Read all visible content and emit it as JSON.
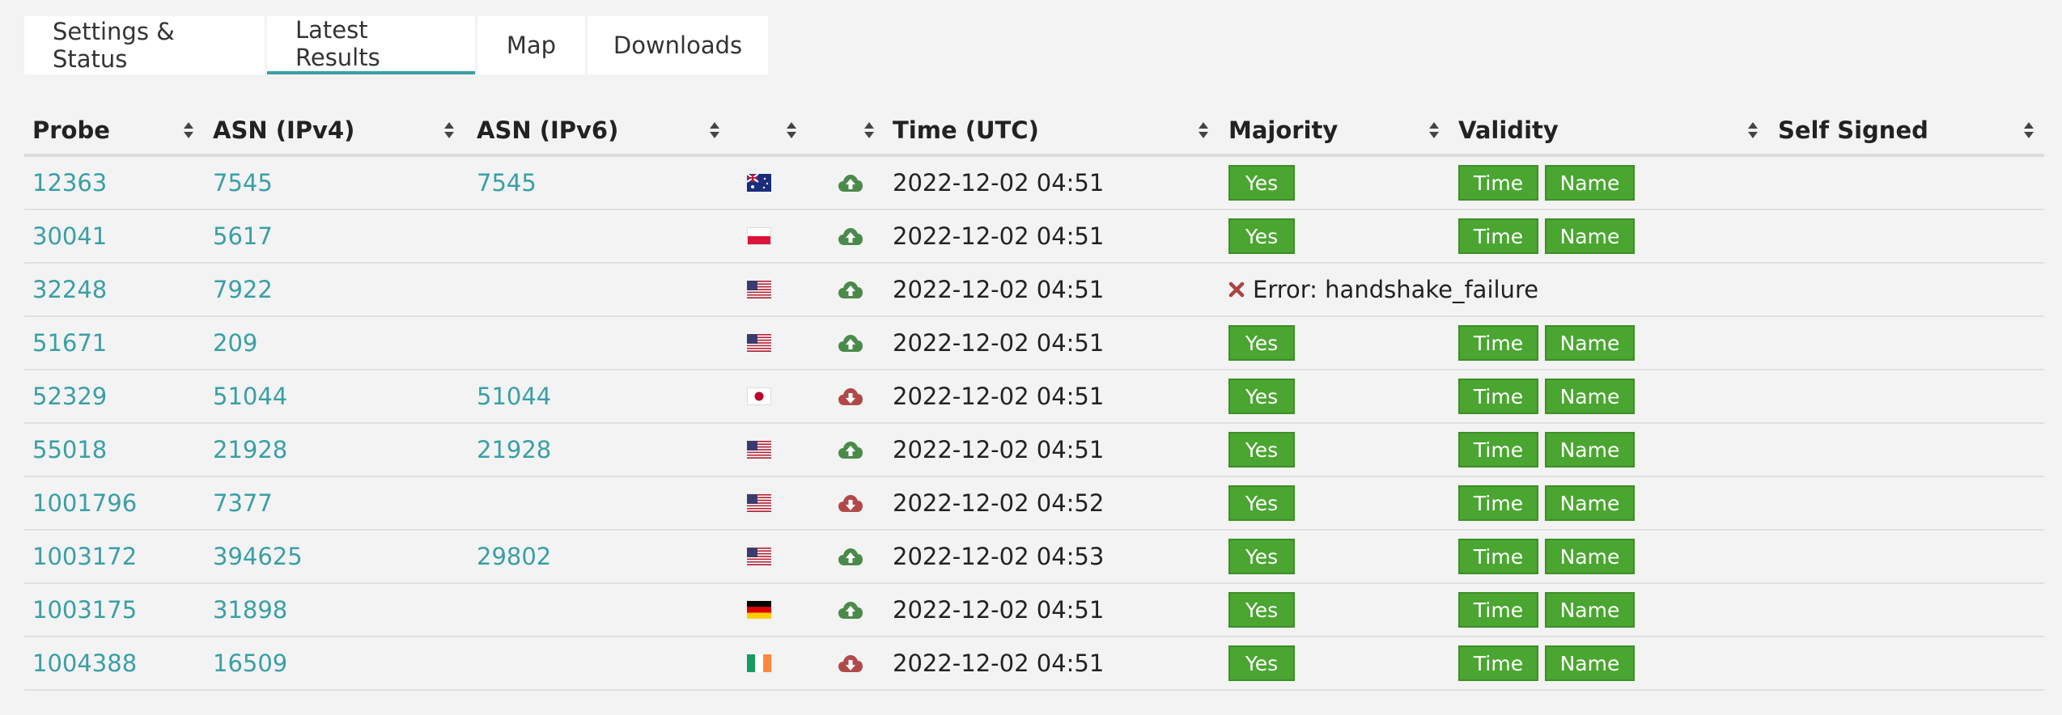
{
  "tabs": [
    {
      "label": "Settings & Status",
      "active": false
    },
    {
      "label": "Latest Results",
      "active": true
    },
    {
      "label": "Map",
      "active": false
    },
    {
      "label": "Downloads",
      "active": false
    }
  ],
  "table": {
    "headers": [
      "Probe",
      "ASN (IPv4)",
      "ASN (IPv6)",
      "",
      "",
      "Time (UTC)",
      "Majority",
      "Validity",
      "Self Signed"
    ],
    "rows": [
      {
        "probe": "12363",
        "asn4": "7545",
        "asn6": "7545",
        "flag": "au",
        "cloud": "up",
        "time": "2022-12-02 04:51",
        "majority": "Yes",
        "validity": [
          "Time",
          "Name"
        ],
        "error": ""
      },
      {
        "probe": "30041",
        "asn4": "5617",
        "asn6": "",
        "flag": "pl",
        "cloud": "up",
        "time": "2022-12-02 04:51",
        "majority": "Yes",
        "validity": [
          "Time",
          "Name"
        ],
        "error": ""
      },
      {
        "probe": "32248",
        "asn4": "7922",
        "asn6": "",
        "flag": "us",
        "cloud": "up",
        "time": "2022-12-02 04:51",
        "majority": "",
        "validity": [],
        "error": "Error: handshake_failure"
      },
      {
        "probe": "51671",
        "asn4": "209",
        "asn6": "",
        "flag": "us",
        "cloud": "up",
        "time": "2022-12-02 04:51",
        "majority": "Yes",
        "validity": [
          "Time",
          "Name"
        ],
        "error": ""
      },
      {
        "probe": "52329",
        "asn4": "51044",
        "asn6": "51044",
        "flag": "jp",
        "cloud": "down",
        "time": "2022-12-02 04:51",
        "majority": "Yes",
        "validity": [
          "Time",
          "Name"
        ],
        "error": ""
      },
      {
        "probe": "55018",
        "asn4": "21928",
        "asn6": "21928",
        "flag": "us",
        "cloud": "up",
        "time": "2022-12-02 04:51",
        "majority": "Yes",
        "validity": [
          "Time",
          "Name"
        ],
        "error": ""
      },
      {
        "probe": "1001796",
        "asn4": "7377",
        "asn6": "",
        "flag": "us",
        "cloud": "down",
        "time": "2022-12-02 04:52",
        "majority": "Yes",
        "validity": [
          "Time",
          "Name"
        ],
        "error": ""
      },
      {
        "probe": "1003172",
        "asn4": "394625",
        "asn6": "29802",
        "flag": "us",
        "cloud": "up",
        "time": "2022-12-02 04:53",
        "majority": "Yes",
        "validity": [
          "Time",
          "Name"
        ],
        "error": ""
      },
      {
        "probe": "1003175",
        "asn4": "31898",
        "asn6": "",
        "flag": "de",
        "cloud": "up",
        "time": "2022-12-02 04:51",
        "majority": "Yes",
        "validity": [
          "Time",
          "Name"
        ],
        "error": ""
      },
      {
        "probe": "1004388",
        "asn4": "16509",
        "asn6": "",
        "flag": "ie",
        "cloud": "down",
        "time": "2022-12-02 04:51",
        "majority": "Yes",
        "validity": [
          "Time",
          "Name"
        ],
        "error": ""
      }
    ]
  },
  "icons": {
    "sort": "sort-icon",
    "cloud_up": "cloud-upload-icon",
    "cloud_down": "cloud-download-icon",
    "error": "close-icon"
  },
  "colors": {
    "accent": "#3a9fa6",
    "success": "#4aa630",
    "cloud_up": "#4a8a4a",
    "cloud_down": "#b04a4a",
    "error": "#a94442"
  }
}
